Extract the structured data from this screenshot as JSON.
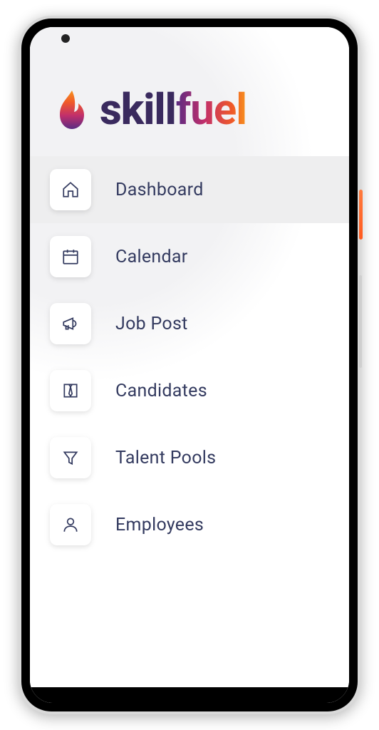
{
  "brand": {
    "name_bold": "skill",
    "name_grad": "fuel"
  },
  "nav": {
    "items": [
      {
        "label": "Dashboard",
        "icon": "home-icon",
        "active": true
      },
      {
        "label": "Calendar",
        "icon": "calendar-icon",
        "active": false
      },
      {
        "label": "Job Post",
        "icon": "megaphone-icon",
        "active": false
      },
      {
        "label": "Candidates",
        "icon": "tie-icon",
        "active": false
      },
      {
        "label": "Talent Pools",
        "icon": "funnel-icon",
        "active": false
      },
      {
        "label": "Employees",
        "icon": "person-icon",
        "active": false
      }
    ]
  }
}
